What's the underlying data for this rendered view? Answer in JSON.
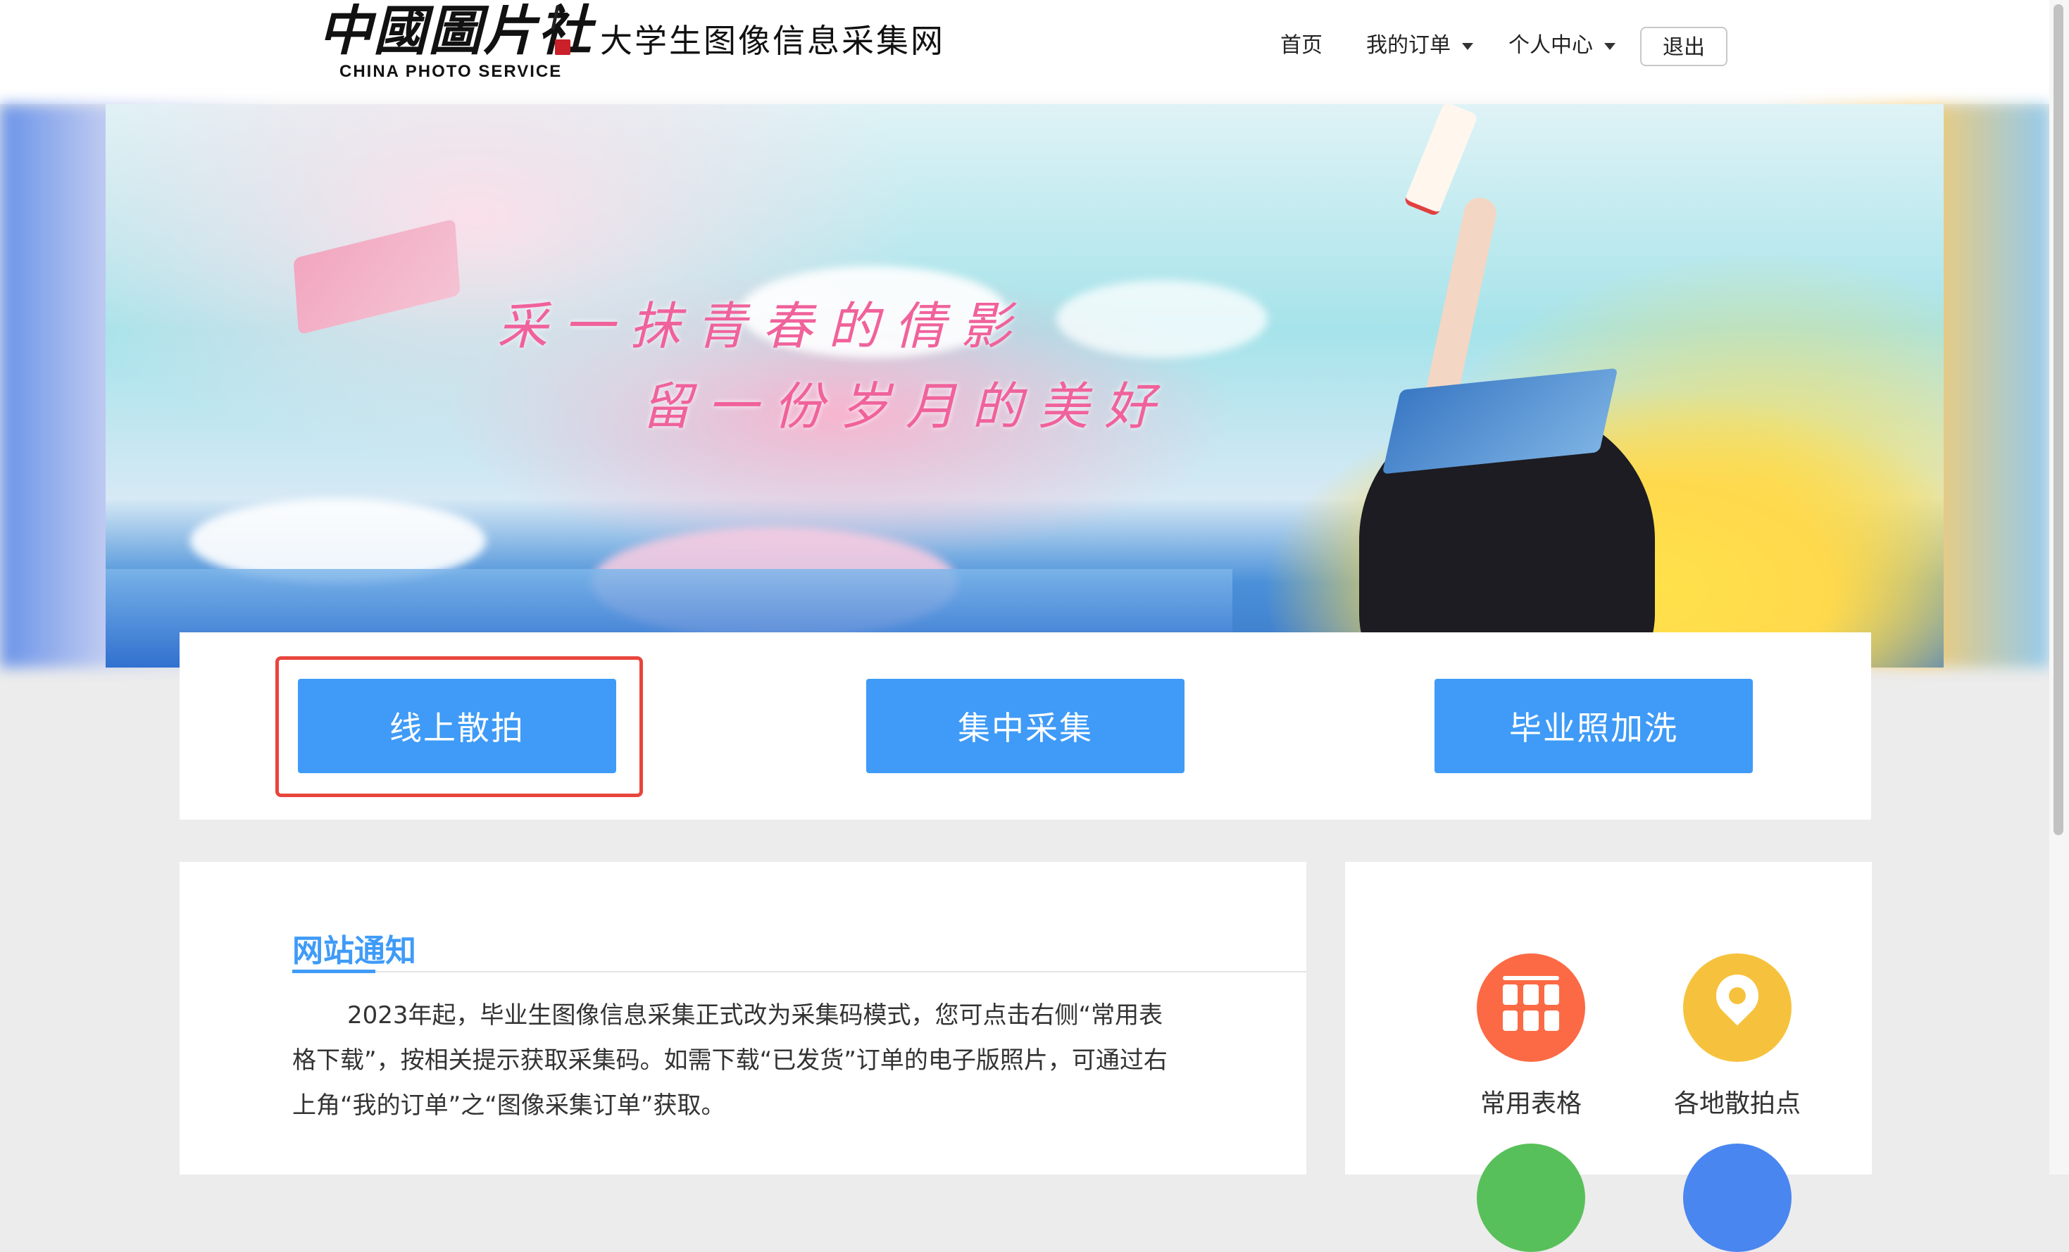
{
  "header": {
    "logo_text": "中國圖片社",
    "logo_en": "CHINA PHOTO SERVICE",
    "site_name": "大学生图像信息采集网",
    "nav": {
      "home": "首页",
      "my_orders": "我的订单",
      "personal_center": "个人中心",
      "logout": "退出"
    }
  },
  "banner": {
    "slogan_line1": "采一抹青春的倩影",
    "slogan_line2": "留一份岁月的美好"
  },
  "actions": {
    "online": "线上散拍",
    "centralized": "集中采集",
    "graduation_print": "毕业照加洗"
  },
  "notice": {
    "title": "网站通知",
    "body": "2023年起，毕业生图像信息采集正式改为采集码模式，您可点击右侧“常用表格下载”，按相关提示获取采集码。如需下载“已发货”订单的电子版照片，可通过右上角“我的订单”之“图像采集订单”获取。"
  },
  "tools": [
    {
      "label": "常用表格",
      "icon": "table-grid-icon",
      "color": "#fb6a45"
    },
    {
      "label": "各地散拍点",
      "icon": "location-pin-icon",
      "color": "#f6c23d"
    },
    {
      "label": "",
      "icon": "green-icon",
      "color": "#58c05a"
    },
    {
      "label": "",
      "icon": "blue-icon",
      "color": "#4a86f0"
    }
  ],
  "colors": {
    "primary": "#3f9bf7",
    "highlight_border": "#e8453c"
  }
}
